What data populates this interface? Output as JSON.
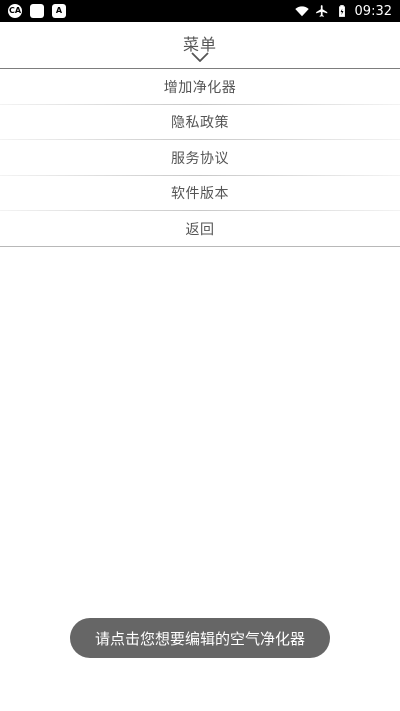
{
  "status_bar": {
    "time": "09:32",
    "left_icons": [
      "ca-icon",
      "notification-square-icon",
      "a-icon"
    ],
    "ca_label": "CA",
    "a_label": "A",
    "right_icons": [
      "wifi-icon",
      "airplane-icon",
      "battery-charging-icon"
    ]
  },
  "header": {
    "title": "菜单"
  },
  "menu": {
    "items": [
      {
        "label": "增加净化器"
      },
      {
        "label": "隐私政策"
      },
      {
        "label": "服务协议"
      },
      {
        "label": "软件版本"
      },
      {
        "label": "返回"
      }
    ]
  },
  "toast": {
    "message": "请点击您想要编辑的空气净化器"
  },
  "colors": {
    "text": "#555555",
    "toast_bg": "#666666",
    "divider": "#7d7d7d"
  }
}
